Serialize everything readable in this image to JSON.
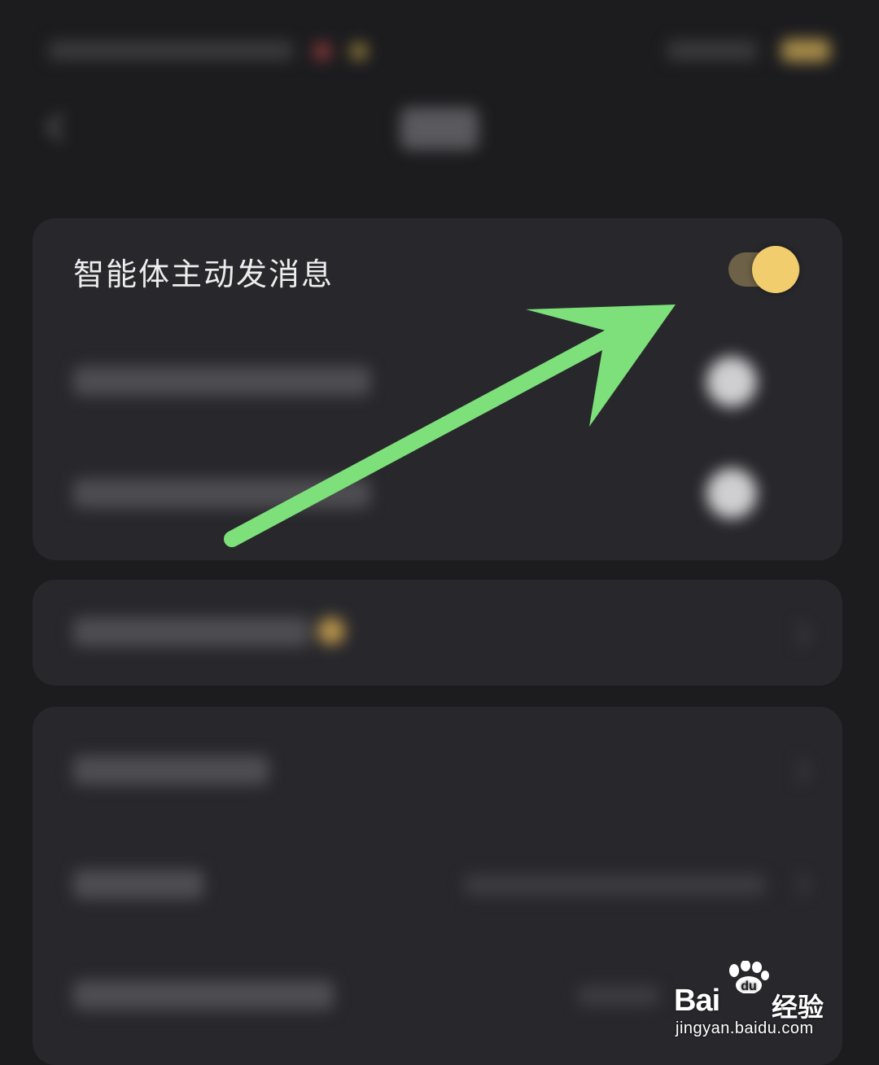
{
  "settings": {
    "agent_proactive_message": {
      "label": "智能体主动发消息",
      "toggle_on": true,
      "toggle_accent": "#f2cd6d"
    }
  },
  "watermark": {
    "brand": "Bai",
    "brand_suffix": "经验",
    "paw_mark": "du",
    "url": "jingyan.baidu.com"
  },
  "annotation": {
    "arrow_color": "#7de07a",
    "icon": "arrow-pointing-to-toggle"
  }
}
